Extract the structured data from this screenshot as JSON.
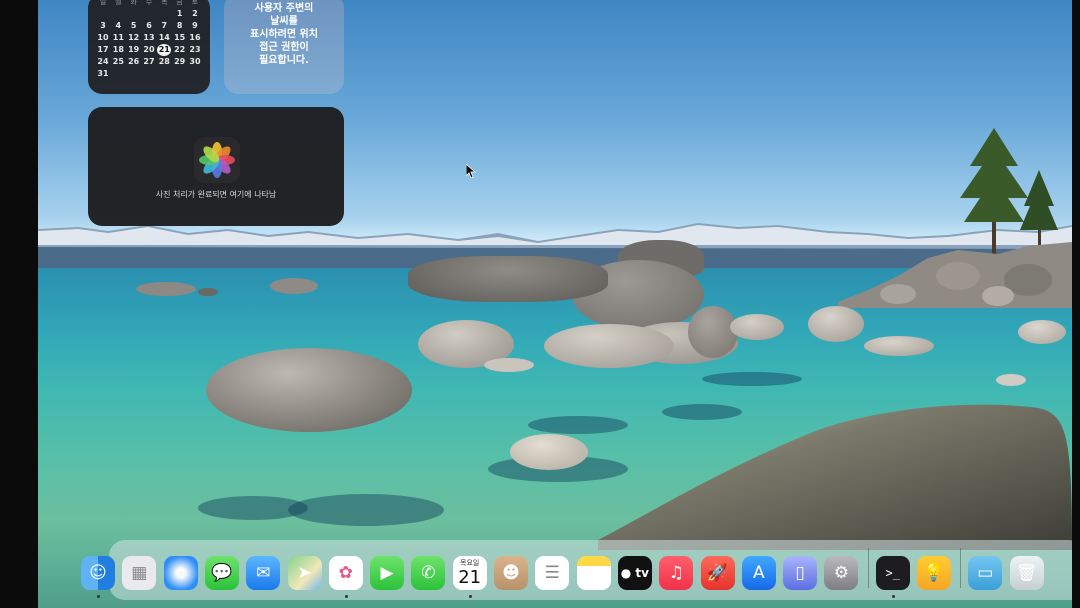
{
  "calendar_widget": {
    "weekdays": [
      "일",
      "월",
      "화",
      "수",
      "목",
      "금",
      "토"
    ],
    "weeks": [
      [
        "",
        "",
        "",
        "",
        "",
        "1",
        "2"
      ],
      [
        "3",
        "4",
        "5",
        "6",
        "7",
        "8",
        "9"
      ],
      [
        "10",
        "11",
        "12",
        "13",
        "14",
        "15",
        "16"
      ],
      [
        "17",
        "18",
        "19",
        "20",
        "21",
        "22",
        "23"
      ],
      [
        "24",
        "25",
        "26",
        "27",
        "28",
        "29",
        "30"
      ],
      [
        "31",
        "",
        "",
        "",
        "",
        "",
        ""
      ]
    ],
    "today": "21"
  },
  "weather_widget": {
    "message": "사용자 주변의\n날씨를\n표시하려면 위치\n접근 권한이\n필요합니다."
  },
  "photos_widget": {
    "icon": "photos-icon",
    "caption": "사진 처리가 완료되면 여기에 나타남"
  },
  "dock": {
    "calendar_day_label": "목요일",
    "calendar_date": "21",
    "tv_label": "tv",
    "items": [
      {
        "name": "finder",
        "icon": "finder-icon",
        "running": true
      },
      {
        "name": "launchpad",
        "icon": "launchpad-icon",
        "running": false
      },
      {
        "name": "safari",
        "icon": "safari-icon",
        "running": false
      },
      {
        "name": "messages",
        "icon": "messages-icon",
        "running": false
      },
      {
        "name": "mail",
        "icon": "mail-icon",
        "running": false
      },
      {
        "name": "maps",
        "icon": "maps-icon",
        "running": false
      },
      {
        "name": "photos",
        "icon": "photos-icon",
        "running": true
      },
      {
        "name": "facetime",
        "icon": "facetime-icon",
        "running": false
      },
      {
        "name": "phone",
        "icon": "phone-icon",
        "running": false
      },
      {
        "name": "calendar",
        "icon": "calendar-icon",
        "running": true
      },
      {
        "name": "contacts",
        "icon": "contacts-icon",
        "running": false
      },
      {
        "name": "reminders",
        "icon": "reminders-icon",
        "running": false
      },
      {
        "name": "notes",
        "icon": "notes-icon",
        "running": false
      },
      {
        "name": "apple-tv",
        "icon": "apple-tv-icon",
        "running": false
      },
      {
        "name": "music",
        "icon": "music-icon",
        "running": false
      },
      {
        "name": "rocket-typist",
        "icon": "rocket-icon",
        "running": false
      },
      {
        "name": "app-store",
        "icon": "app-store-icon",
        "running": false
      },
      {
        "name": "iphone-mirroring",
        "icon": "iphone-mirroring-icon",
        "running": false
      },
      {
        "name": "system-settings",
        "icon": "gear-icon",
        "running": false
      },
      {
        "name": "terminal",
        "icon": "terminal-icon",
        "running": true
      },
      {
        "name": "tips",
        "icon": "lightbulb-icon",
        "running": false
      },
      {
        "name": "downloads",
        "icon": "folder-icon",
        "running": false
      },
      {
        "name": "trash",
        "icon": "trash-icon",
        "running": false
      }
    ]
  },
  "colors": {
    "sky": "#5d9fd4",
    "lake": "#3fb7b3",
    "dock_bg": "#d2e1e1"
  }
}
